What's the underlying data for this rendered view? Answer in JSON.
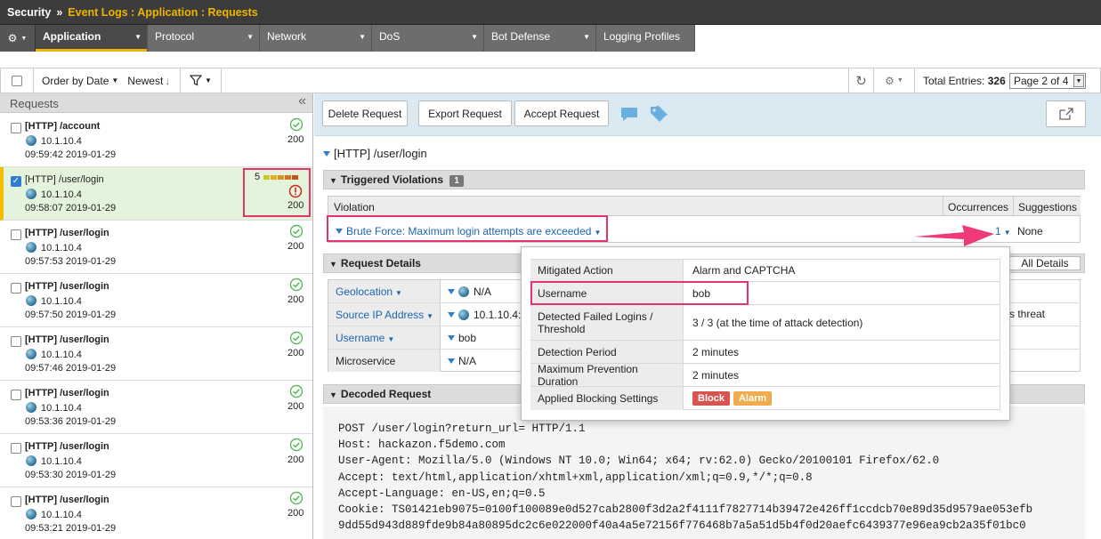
{
  "breadcrumb": {
    "section": "Security",
    "separator": "»",
    "path": "Event Logs : Application : Requests"
  },
  "nav": {
    "tabs": [
      {
        "label": "Application",
        "active": true
      },
      {
        "label": "Protocol"
      },
      {
        "label": "Network"
      },
      {
        "label": "DoS"
      },
      {
        "label": "Bot Defense"
      },
      {
        "label": "Logging Profiles"
      }
    ]
  },
  "toolbar": {
    "order_label": "Order by Date",
    "newest_label": "Newest",
    "total_label": "Total Entries:",
    "total_value": "326",
    "page_select": "Page 2 of 4"
  },
  "left": {
    "title": "Requests",
    "collapse": "«",
    "requests": [
      {
        "path": "[HTTP] /account",
        "ip": "10.1.10.4",
        "time": "09:59:42 2019-01-29",
        "status": "200",
        "selected": false
      },
      {
        "path": "[HTTP] /user/login",
        "ip": "10.1.10.4",
        "time": "09:58:07 2019-01-29",
        "status": "200",
        "selected": true,
        "rating": "5"
      },
      {
        "path": "[HTTP] /user/login",
        "ip": "10.1.10.4",
        "time": "09:57:53 2019-01-29",
        "status": "200",
        "selected": false
      },
      {
        "path": "[HTTP] /user/login",
        "ip": "10.1.10.4",
        "time": "09:57:50 2019-01-29",
        "status": "200",
        "selected": false
      },
      {
        "path": "[HTTP] /user/login",
        "ip": "10.1.10.4",
        "time": "09:57:46 2019-01-29",
        "status": "200",
        "selected": false
      },
      {
        "path": "[HTTP] /user/login",
        "ip": "10.1.10.4",
        "time": "09:53:36 2019-01-29",
        "status": "200",
        "selected": false
      },
      {
        "path": "[HTTP] /user/login",
        "ip": "10.1.10.4",
        "time": "09:53:30 2019-01-29",
        "status": "200",
        "selected": false
      },
      {
        "path": "[HTTP] /user/login",
        "ip": "10.1.10.4",
        "time": "09:53:21 2019-01-29",
        "status": "200",
        "selected": false
      }
    ]
  },
  "actions": {
    "delete": "Delete Request",
    "export": "Export Request",
    "accept": "Accept Request"
  },
  "detail": {
    "title": "[HTTP] /user/login",
    "violations_header": "Triggered Violations",
    "violations_count": "1",
    "col_violation": "Violation",
    "col_occurrences": "Occurrences",
    "col_suggestions": "Suggestions",
    "violation": "Brute Force: Maximum login attempts are exceeded",
    "occurrences": "1",
    "suggestions": "None",
    "request_details_header": "Request Details",
    "all_details": "All Details",
    "details": [
      {
        "label": "Geolocation",
        "value": "N/A",
        "link": true
      },
      {
        "label": "Source IP Address",
        "value": "10.1.10.4:502",
        "link": true
      },
      {
        "label": "Username",
        "value": "bob",
        "link": true
      },
      {
        "label": "Microservice",
        "value": "N/A",
        "link": false
      }
    ],
    "right_fragment": "s threat",
    "decoded_header": "Decoded Request",
    "decoded_lines": [
      "POST /user/login?return_url= HTTP/1.1",
      "Host: hackazon.f5demo.com",
      "User-Agent: Mozilla/5.0 (Windows NT 10.0; Win64; x64; rv:62.0) Gecko/20100101 Firefox/62.0",
      "Accept: text/html,application/xhtml+xml,application/xml;q=0.9,*/*;q=0.8",
      "Accept-Language: en-US,en;q=0.5",
      "Cookie: TS01421eb9075=0100f100089e0d527cab2800f3d2a2f4111f7827714b39472e426ff1ccdcb70e89d35d9579ae053efb",
      "9dd55d943d889fde9b84a80895dc2c6e022000f40a4a5e72156f776468b7a5a51d5b4f0d20aefc6439377e96ea9cb2a35f01bc0"
    ]
  },
  "popover": {
    "rows": [
      {
        "key": "Mitigated Action",
        "value": "Alarm and CAPTCHA"
      },
      {
        "key": "Username",
        "value": "bob"
      },
      {
        "key": "Detected Failed Logins / Threshold",
        "value": "3 / 3 (at the time of attack detection)"
      },
      {
        "key": "Detection Period",
        "value": "2 minutes"
      },
      {
        "key": "Maximum Prevention Duration",
        "value": "2 minutes"
      },
      {
        "key": "Applied Blocking Settings",
        "value": ""
      }
    ],
    "badge_block": "Block",
    "badge_alarm": "Alarm"
  },
  "colors": {
    "accent": "#f0b400",
    "link": "#1d64b0",
    "highlight": "#e5336b",
    "badge_block": "#d9534f",
    "badge_alarm": "#f0ad4e",
    "ok_green": "#5cb85c",
    "alert_red": "#d9231d"
  }
}
